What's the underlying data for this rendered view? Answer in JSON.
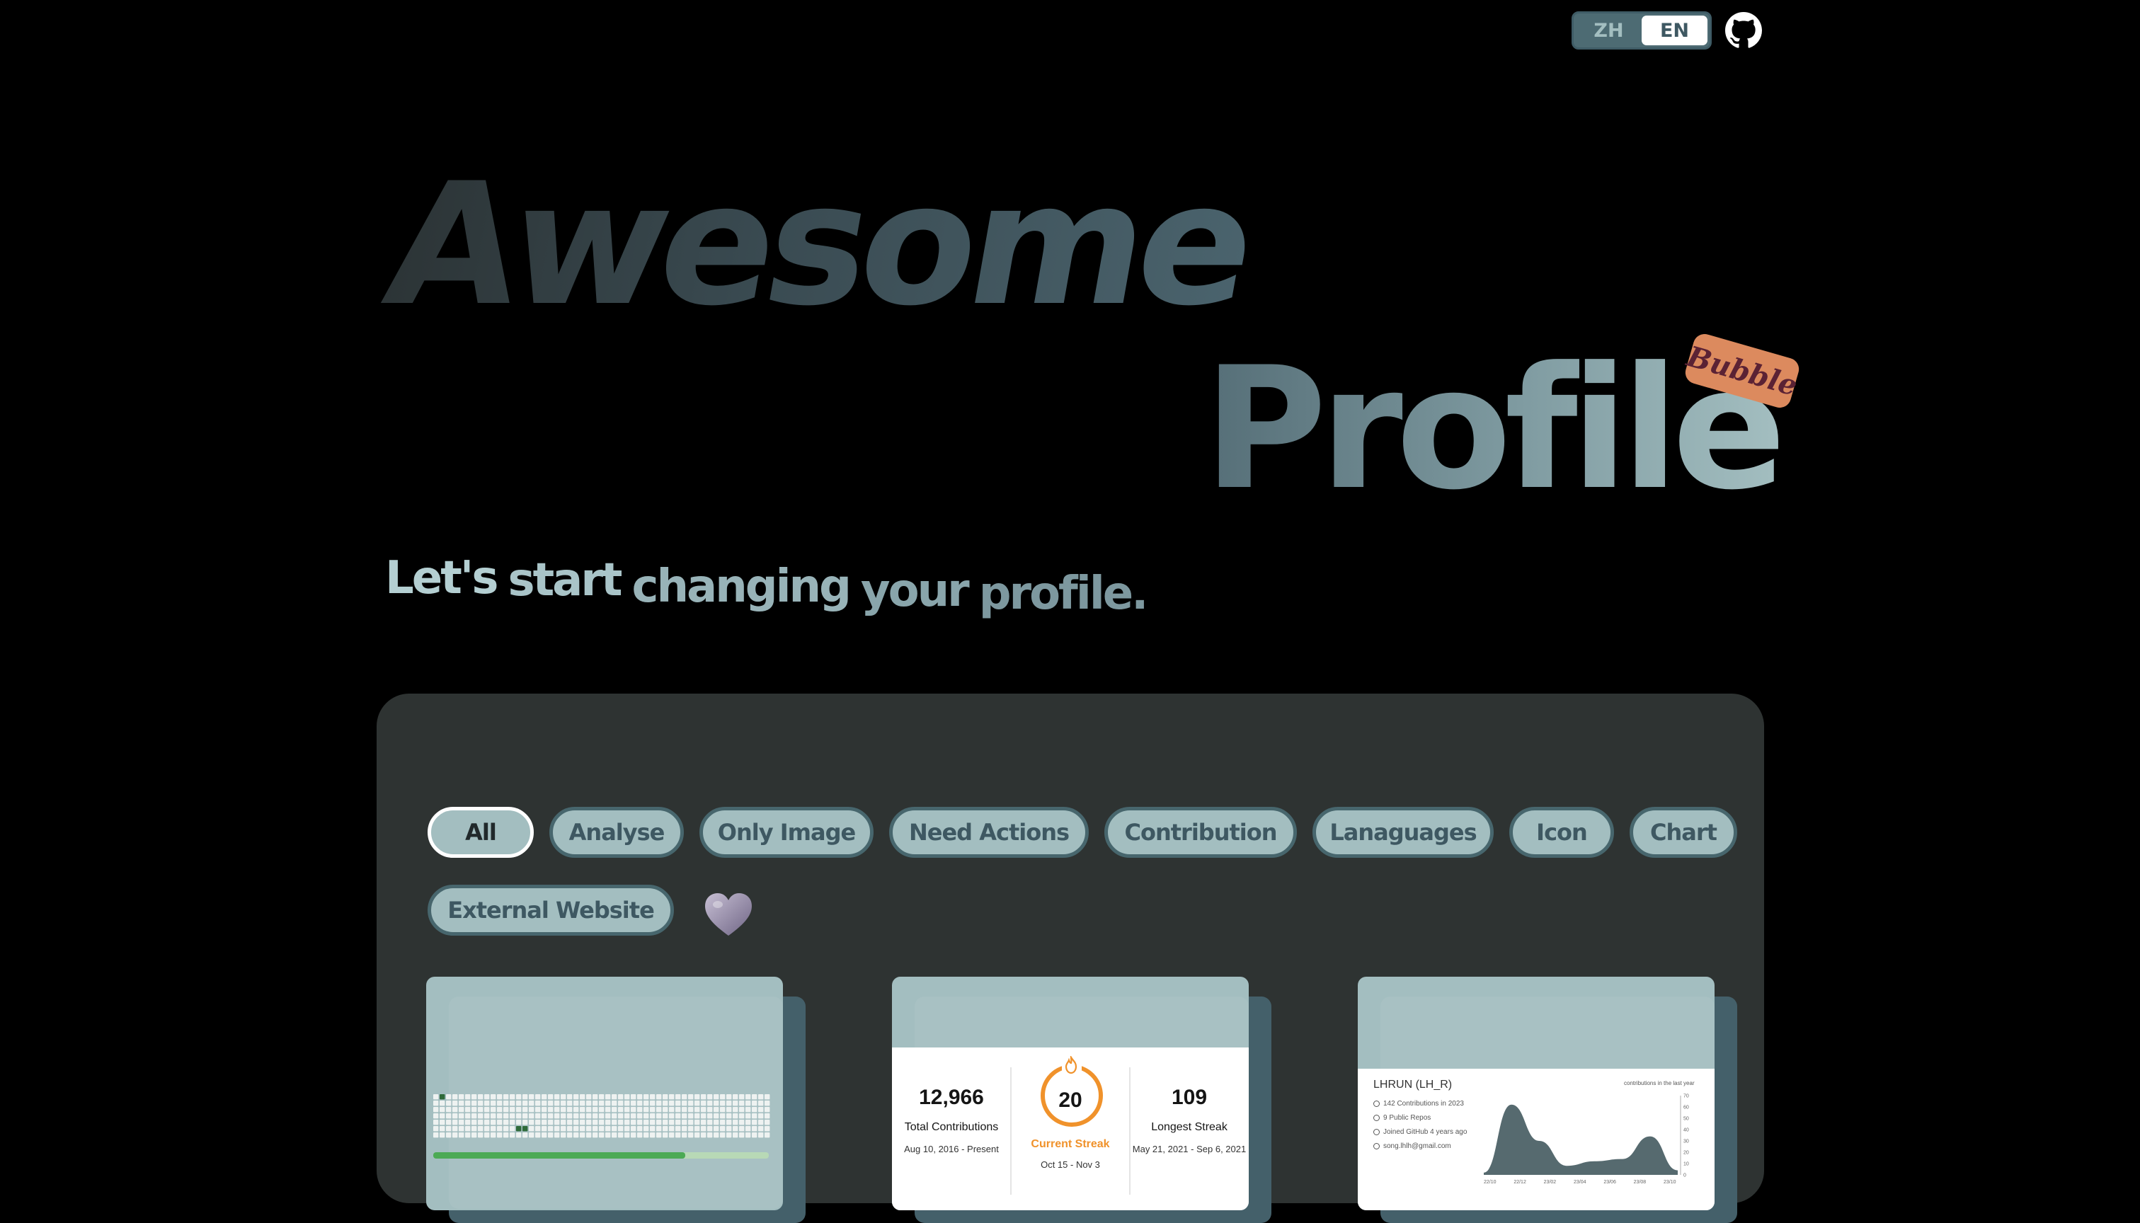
{
  "header": {
    "languages": [
      "ZH",
      "EN"
    ],
    "active_language": "EN",
    "github_icon": "github-icon"
  },
  "hero": {
    "word1": "Awesome",
    "word2": "Profile",
    "badge": "Bubble",
    "tagline": [
      "Let's",
      "start",
      "changing",
      "your",
      "profile."
    ]
  },
  "filters": {
    "items": [
      "All",
      "Analyse",
      "Only Image",
      "Need Actions",
      "Contribution",
      "Lanaguages",
      "Icon",
      "Chart",
      "External Website"
    ],
    "active": "All",
    "favorite_icon": "heart-icon"
  },
  "cards": [
    {
      "kind": "contribution-grid",
      "progress": 0.75
    },
    {
      "kind": "streak-stats",
      "total": {
        "value": "12,966",
        "label": "Total Contributions",
        "range": "Aug 10, 2016 - Present"
      },
      "current": {
        "value": "20",
        "label": "Current Streak",
        "range": "Oct 15 - Nov 3"
      },
      "longest": {
        "value": "109",
        "label": "Longest Streak",
        "range": "May 21, 2021 - Sep 6, 2021"
      }
    },
    {
      "kind": "github-profile",
      "username": "LHRUN (LH_R)",
      "stats": [
        "142 Contributions in 2023",
        "9 Public Repos",
        "Joined GitHub 4 years ago",
        "song.lhlh@gmail.com"
      ],
      "chart_title": "contributions in the last year"
    }
  ],
  "chart_data": {
    "type": "area",
    "title": "contributions in the last year",
    "x": [
      "22/10",
      "22/12",
      "23/02",
      "23/04",
      "23/06",
      "23/08",
      "23/10"
    ],
    "series": [
      {
        "values": [
          2,
          62,
          30,
          8,
          12,
          14,
          34,
          4
        ]
      }
    ],
    "yticks": [
      "0",
      "10",
      "20",
      "30",
      "40",
      "50",
      "60",
      "70"
    ],
    "ylim": [
      0,
      70
    ],
    "color": "#566a6f"
  },
  "colors": {
    "background": "#000000",
    "panel": "#2e3332",
    "pill": "#a3bec0",
    "pill_border": "#47666d",
    "accent_orange": "#f0922b",
    "badge": "#dc8a5e"
  }
}
